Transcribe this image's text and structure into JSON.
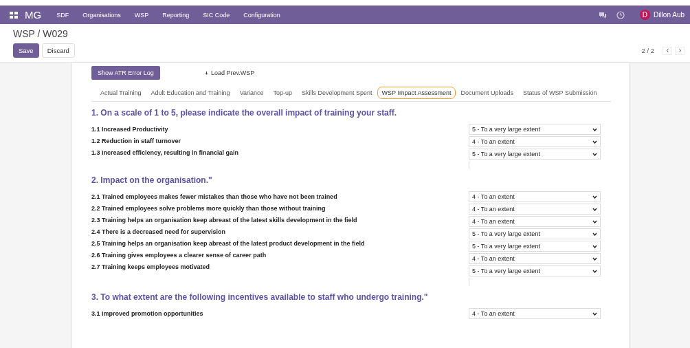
{
  "navbar": {
    "app_name": "MG",
    "menu": [
      "SDF",
      "Organisations",
      "WSP",
      "Reporting",
      "SIC Code",
      "Configuration"
    ],
    "user": {
      "initial": "D",
      "name": "Dillon Aub"
    }
  },
  "breadcrumb": "WSP / W029",
  "buttons": {
    "save": "Save",
    "discard": "Discard"
  },
  "pager": "2 / 2",
  "actions": {
    "error_log": "Show ATR Error Log",
    "load_prev": "Load Prev.WSP"
  },
  "tabs": [
    {
      "label": "Actual Training",
      "selected": false
    },
    {
      "label": "Adult Education and Training",
      "selected": false
    },
    {
      "label": "Variance",
      "selected": false
    },
    {
      "label": "Top-up",
      "selected": false
    },
    {
      "label": "Skills Development Spent",
      "selected": false
    },
    {
      "label": "WSP Impact Assessment",
      "selected": true
    },
    {
      "label": "Document Uploads",
      "selected": false
    },
    {
      "label": "Status of WSP Submission",
      "selected": false
    }
  ],
  "sections": [
    {
      "heading": "1. On a scale of 1 to 5, please indicate the overall impact of training your staff.",
      "questions": [
        {
          "label": "1.1 Increased Productivity",
          "answer": "5 - To a very large extent"
        },
        {
          "label": "1.2 Reduction in staff turnover",
          "answer": "4 - To an extent"
        },
        {
          "label": "1.3 Increased efficiency, resulting in financial gain",
          "answer": "5 - To a very large extent"
        }
      ]
    },
    {
      "heading": "2. Impact on the organisation.\"",
      "questions": [
        {
          "label": "2.1 Trained employees makes fewer mistakes than those who have not been trained",
          "answer": "4 - To an extent"
        },
        {
          "label": "2.2 Trained employees solve problems more quickly than those without training",
          "answer": "4 - To an extent"
        },
        {
          "label": "2.3 Training helps an organisation keep abreast of the latest skills development in the field",
          "answer": "4 - To an extent"
        },
        {
          "label": "2.4 There is a decreased need for supervision",
          "answer": "5 - To a very large extent"
        },
        {
          "label": "2.5 Training helps an organisation keep abreast of the latest product development in the field",
          "answer": "5 - To a very large extent"
        },
        {
          "label": "2.6 Training gives employees a clearer sense of career path",
          "answer": "4 - To an extent"
        },
        {
          "label": "2.7 Training keeps employees motivated",
          "answer": "5 - To a very large extent"
        }
      ]
    },
    {
      "heading": "3. To what extent are the following incentives available to staff who undergo training.\"",
      "questions": [
        {
          "label": "3.1 Improved promotion opportunities",
          "answer": "4 - To an extent"
        }
      ]
    }
  ]
}
